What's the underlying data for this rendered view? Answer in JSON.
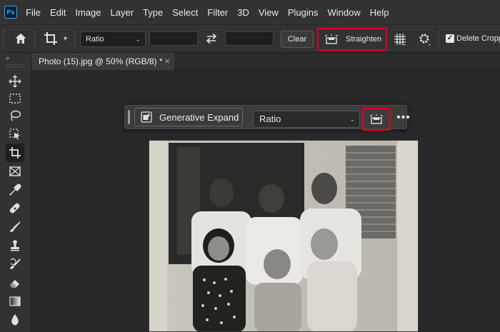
{
  "app": {
    "logo_text": "Ps"
  },
  "menu": [
    "File",
    "Edit",
    "Image",
    "Layer",
    "Type",
    "Select",
    "Filter",
    "3D",
    "View",
    "Plugins",
    "Window",
    "Help"
  ],
  "options_bar": {
    "ratio_label": "Ratio",
    "clear_label": "Clear",
    "straighten_label": "Straighten",
    "delete_cropped_label": "Delete Croppe",
    "delete_cropped_checked": true
  },
  "document_tab": {
    "title": "Photo (15).jpg @ 50% (RGB/8) *",
    "close": "×"
  },
  "contextual_bar": {
    "generative_expand_label": "Generative Expand",
    "ratio_label": "Ratio",
    "more_label": "•••"
  },
  "toolbar": {
    "collapse": "»"
  },
  "colors": {
    "highlight": "#e0001b",
    "accent": "#31a8ff"
  }
}
